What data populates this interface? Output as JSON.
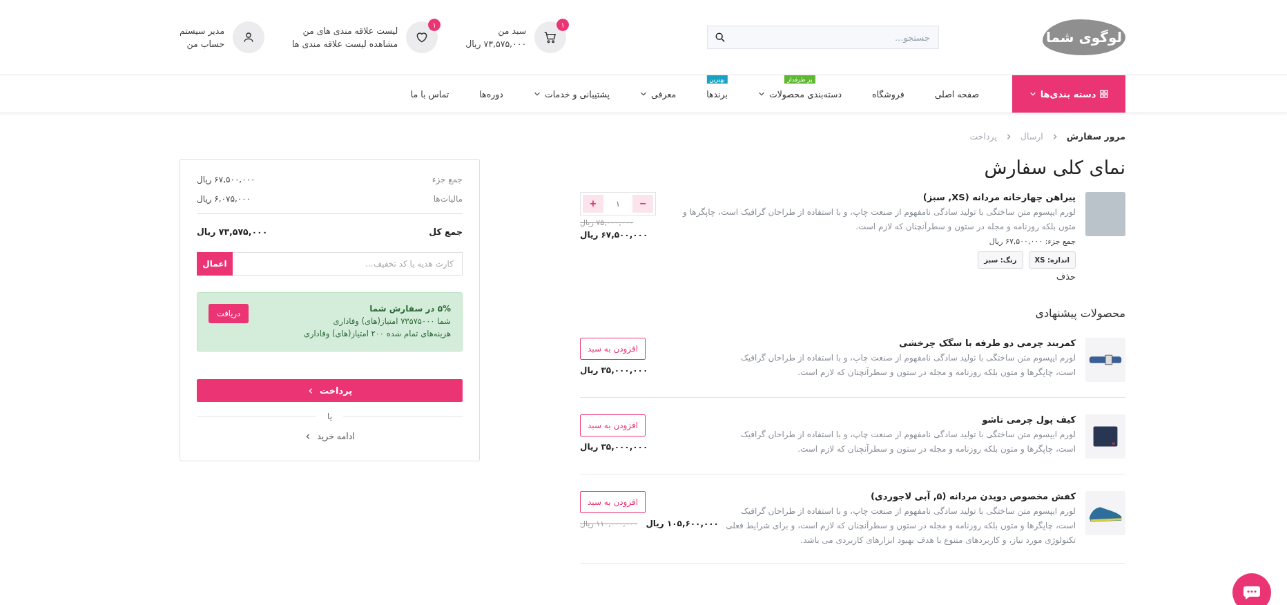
{
  "header": {
    "logo": "لوگوی شما",
    "search": {
      "placeholder": "جستجو..."
    },
    "cart": {
      "badge": "۱",
      "title": "سبد من",
      "subtitle": "۷۳,۵۷۵,۰۰۰ ریال"
    },
    "wishlist": {
      "badge": "۱",
      "title": "لیست علاقه مندی های من",
      "subtitle": "مشاهده لیست علاقه مندی ها"
    },
    "account": {
      "title": "مدیر سیستم",
      "subtitle": "حساب من"
    }
  },
  "nav": {
    "categories_button": "دسته بندی‌ها",
    "items": [
      {
        "label": "صفحه اصلی",
        "dropdown": false
      },
      {
        "label": "فروشگاه",
        "dropdown": false
      },
      {
        "label": "دسته‌بندی محصولات",
        "dropdown": true,
        "badge": "پر طرفدار",
        "color": "#5fb832"
      },
      {
        "label": "برندها",
        "dropdown": false,
        "badge": "بهترین",
        "color": "#17a2c4"
      },
      {
        "label": "معرفی",
        "dropdown": true
      },
      {
        "label": "پشتیبانی و خدمات",
        "dropdown": true
      },
      {
        "label": "دوره‌ها",
        "dropdown": false
      },
      {
        "label": "تماس با ما",
        "dropdown": false
      }
    ]
  },
  "breadcrumb": [
    {
      "label": "مرور سفارش",
      "selected": true
    },
    {
      "label": "ارسال",
      "selected": false
    },
    {
      "label": "پرداخت",
      "selected": false
    }
  ],
  "title": "نمای کلی سفارش",
  "order_item": {
    "name": "پیراهن چهارخانه مردانه (XS, سبز)",
    "description": "لورم ایپسوم متن ساختگی با تولید سادگی نامفهوم از صنعت چاپ، و با استفاده از طراحان گرافیک است، چاپگرها و متون بلکه روزنامه و مجله در ستون و سطرآنچنان که لازم است.",
    "subtotal": "جمع جزء: ۶۷,۵۰۰,۰۰۰ ریال",
    "options": [
      "اندازه: XS",
      "رنگ: سبز"
    ],
    "remove": "حذف",
    "quantity": "۱",
    "minus": "−",
    "plus": "+",
    "old_price": "۷۵,۰۰۰,۰۰۰ ریال",
    "price": "۶۷,۵۰۰,۰۰۰ ریال"
  },
  "suggested": {
    "title": "محصولات پیشنهادی",
    "items": [
      {
        "kind": "belt",
        "name": "کمربند چرمی دو طرفه با سگک چرخشی",
        "description": "لورم ایپسوم متن ساختگی با تولید سادگی نامفهوم از صنعت چاپ، و با استفاده از طراحان گرافیک است، چاپگرها و متون بلکه روزنامه و مجله در ستون و سطرآنچنان که لازم است.",
        "button": "افزودن به سبد",
        "price": "۳۵,۰۰۰,۰۰۰ ریال"
      },
      {
        "kind": "wallet",
        "name": "کیف پول چرمی تاشو",
        "description": "لورم ایپسوم متن ساختگی با تولید سادگی نامفهوم از صنعت چاپ، و با استفاده از طراحان گرافیک است، چاپگرها و متون بلکه روزنامه و مجله در ستون و سطرآنچنان که لازم است.",
        "button": "افزودن به سبد",
        "price": "۳۵,۰۰۰,۰۰۰ ریال"
      },
      {
        "kind": "shoe",
        "name": "کفش مخصوص دویدن مردانه (۵, آبی لاجوردی)",
        "description": "لورم ایپسوم متن ساختگی با تولید سادگی نامفهوم از صنعت چاپ، و با استفاده از طراحان گرافیک است، چاپگرها و متون بلکه روزنامه و مجله در ستون و سطرآنچنان که لازم است، و برای شرایط فعلی تکنولوژی مورد نیاز، و کاربردهای متنوع با هدف بهبود ابزارهای کاربردی می باشد.",
        "button": "افزودن به سبد",
        "price": "۱۰۵,۶۰۰,۰۰۰ ریال",
        "old_price": "۱۱۰,۰۰۰,۰۰۰ ریال"
      }
    ]
  },
  "summary": {
    "rows": [
      {
        "label": "جمع جزء",
        "value": "۶۷,۵۰۰,۰۰۰ ریال"
      },
      {
        "label": "مالیات‌ها",
        "value": "۶,۰۷۵,۰۰۰ ریال"
      }
    ],
    "total": {
      "label": "جمع کل",
      "value": "۷۳,۵۷۵,۰۰۰ ریال"
    },
    "coupon": {
      "placeholder": "کارت هدیه یا کد تخفیف...",
      "button": "اعمال"
    },
    "reward": {
      "title": "۵% در سفارش شما",
      "lines": [
        "شما ۷۳۵۷۵۰۰۰ امتیاز(های) وفاداری",
        "هزینه‌های تمام شده ۲۰۰ امتیاز(های) وفاداری"
      ],
      "button": "دریافت"
    },
    "checkout": "پرداخت",
    "or": "یا",
    "continue": "ادامه خرید"
  }
}
